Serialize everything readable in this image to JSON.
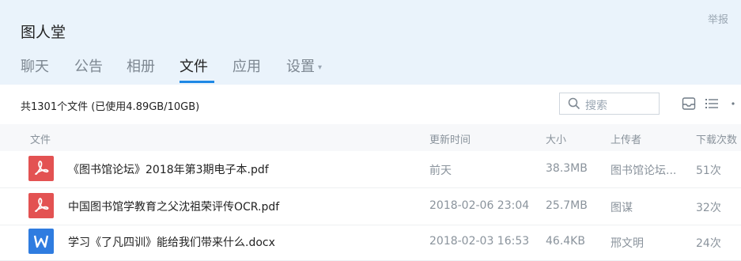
{
  "header": {
    "group_name": "图人堂",
    "report_label": "举报"
  },
  "tabs": [
    {
      "label": "聊天"
    },
    {
      "label": "公告"
    },
    {
      "label": "相册"
    },
    {
      "label": "文件"
    },
    {
      "label": "应用"
    },
    {
      "label": "设置"
    }
  ],
  "active_tab": "文件",
  "toolbar": {
    "summary": "共1301个文件 (已使用4.89GB/10GB)",
    "search_placeholder": "搜索"
  },
  "columns": {
    "file": "文件",
    "updated": "更新时间",
    "size": "大小",
    "uploader": "上传者",
    "downloads": "下载次数"
  },
  "files": [
    {
      "name": "《图书馆论坛》2018年第3期电子本.pdf",
      "updated": "前天",
      "size": "38.3MB",
      "uploader": "图书馆论坛...",
      "downloads": "51次",
      "type": "pdf"
    },
    {
      "name": "中国图书馆学教育之父沈祖荣评传OCR.pdf",
      "updated": "2018-02-06 23:04",
      "size": "25.7MB",
      "uploader": "图谋",
      "downloads": "32次",
      "type": "pdf"
    },
    {
      "name": "学习《了凡四训》能给我们带来什么.docx",
      "updated": "2018-02-03 16:53",
      "size": "46.4KB",
      "uploader": "邢文明",
      "downloads": "24次",
      "type": "docx"
    }
  ],
  "colors": {
    "accent": "#1e88e5",
    "pdf": "#e35252",
    "word": "#2f7ce0",
    "header_bg": "#eaf3fb"
  },
  "icons": [
    "search-icon",
    "upload-icon",
    "list-view-icon",
    "more-icon",
    "pdf-icon",
    "word-icon",
    "caret-down-icon"
  ]
}
